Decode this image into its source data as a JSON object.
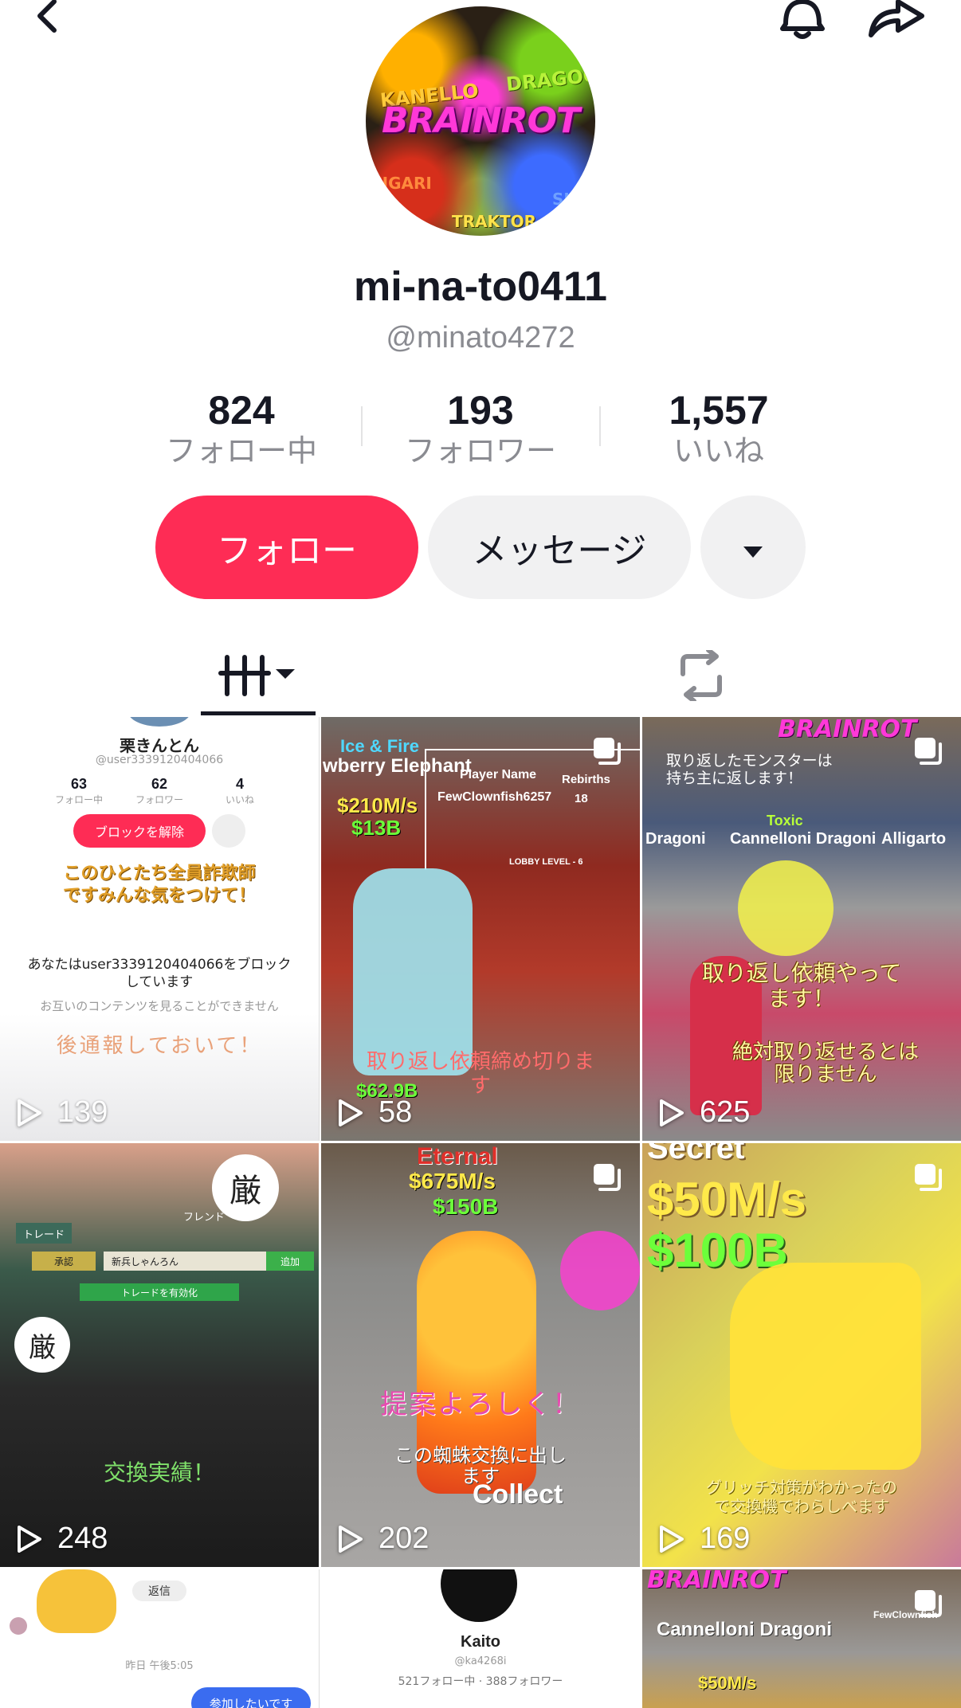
{
  "profile": {
    "username": "mi-na-to0411",
    "handle": "@minato4272",
    "avatar_text": {
      "brand": "BRAINROT",
      "left": "KANELLO",
      "right": "DRAGOO",
      "bottom": "TRAKTOR",
      "bottom_left": "CIGARI",
      "bottom_right": "SKIBI"
    }
  },
  "stats": [
    {
      "value": "824",
      "label": "フォロー中"
    },
    {
      "value": "193",
      "label": "フォロワー"
    },
    {
      "value": "1,557",
      "label": "いいね"
    }
  ],
  "actions": {
    "follow_label": "フォロー",
    "message_label": "メッセージ"
  },
  "colors": {
    "accent": "#fe2c55",
    "secondary_button": "#f1f1f2",
    "muted_text": "#8a8b91"
  },
  "icons": {
    "back": "chevron-left-icon",
    "bell": "bell-icon",
    "share": "share-arrow-icon",
    "more": "caret-down-icon",
    "videos_tab": "grid-bars-icon",
    "repost_tab": "repost-icon",
    "play": "play-icon",
    "multi_photo": "stacked-photos-icon"
  },
  "videos": [
    {
      "views": "139",
      "captions": [
        "栗きんとん",
        "@user3339120404066",
        "63",
        "フォロー中",
        "62",
        "フォロワー",
        "4",
        "いいね",
        "ブロックを解除",
        "このひとたち全員詐欺師",
        "ですみんな気をつけて！",
        "あなたはuser3339120404066をブロック",
        "しています",
        "お互いのコンテンツを見ることができません",
        "後通報しておいて！"
      ]
    },
    {
      "views": "58",
      "captions": [
        "Ice & Fire",
        "wberry Elephant",
        "Player Name",
        "FewClownfish6257",
        "Rebirths",
        "18",
        "$210M/s",
        "$13B",
        "LOBBY LEVEL - 6",
        "取り返し依頼締め切りま",
        "す",
        "$62.9B"
      ]
    },
    {
      "views": "625",
      "captions": [
        "BRAINROT",
        "取り返したモンスターは",
        "持ち主に返します！",
        "Dragoni",
        "Cannelloni Dragoni",
        "Alligarto",
        "Toxic",
        "取り返し依頼やって",
        "ます！",
        "絶対取り返せるとは",
        "限りません"
      ]
    },
    {
      "views": "248",
      "captions": [
        "厳",
        "トレード",
        "フレンド",
        "承認",
        "新兵しゃんろん",
        "追加",
        "トレードを有効化",
        "交換実績！"
      ]
    },
    {
      "views": "202",
      "captions": [
        "Eternal",
        "$675M/s",
        "$150B",
        "提案よろしく！",
        "この蜘蛛交換に出し",
        "ます",
        "Collect"
      ]
    },
    {
      "views": "169",
      "captions": [
        "Secret",
        "$50M/s",
        "$100B",
        "グリッチ対策がわかったの",
        "で交換機でわらしべます"
      ]
    },
    {
      "views": "",
      "captions": [
        "返信",
        "昨日 午後5:05",
        "参加したいです"
      ]
    },
    {
      "views": "",
      "captions": [
        "Kaito",
        "@ka4268i",
        "521フォロー中 · 388フォロワー"
      ]
    },
    {
      "views": "",
      "captions": [
        "BRAINROT",
        "Cannelloni Dragoni",
        "FewClownfish",
        "$50M/s"
      ]
    }
  ]
}
